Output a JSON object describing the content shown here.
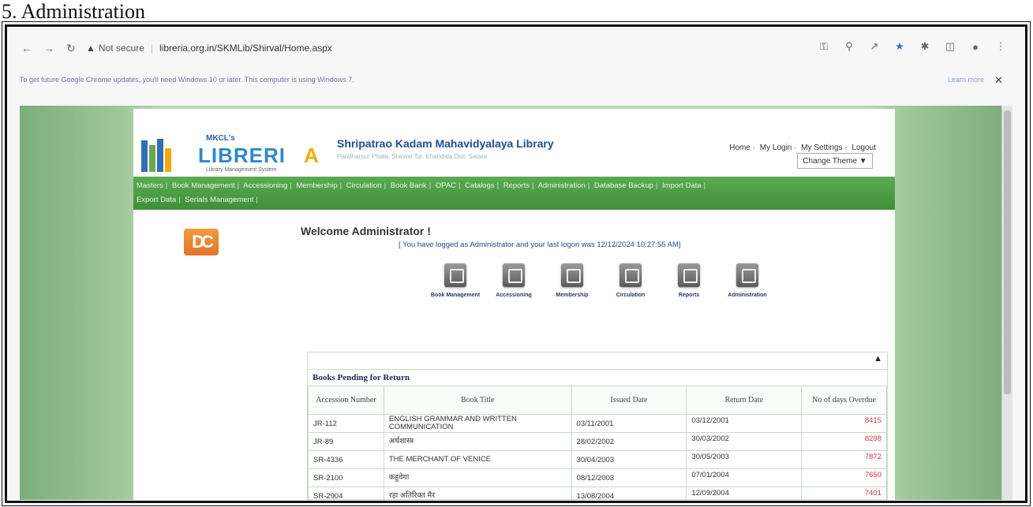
{
  "doc": {
    "heading": "5. Administration"
  },
  "browser": {
    "url_security": "Not secure",
    "url": "libreria.org.in/SKMLib/Shirval/Home.aspx",
    "infobar_text": "To get future Google Chrome updates, you'll need Windows 10 or later. This computer is using Windows 7.",
    "infobar_link": "Learn more"
  },
  "header": {
    "logo_small": "MKCL's",
    "logo_name": "LIBRERI",
    "logo_name_tail": "A",
    "logo_sub": "Library Management System",
    "library_name": "Shripatrao Kadam Mahavidyalaya Library",
    "library_address": "Pandharpur Phata, Shirwal Tal. Khandala Dist. Satara",
    "links": [
      "Home",
      "My Login",
      "My Settings",
      "Logout"
    ],
    "change_theme": "Change Theme"
  },
  "nav": {
    "row1": [
      "Masters",
      "Book Management",
      "Accessioning",
      "Membership",
      "Circulation",
      "Book Bank",
      "OPAC",
      "Catalogs",
      "Reports",
      "Administration",
      "Database Backup",
      "Import Data"
    ],
    "row2": [
      "Export Data",
      "Serials Management"
    ]
  },
  "main": {
    "welcome": "Welcome Administrator !",
    "logon_message": "[ You have logged as Administrator and your last logon was 12/12/2024 10:27:55 AM]",
    "quick_actions": [
      "Book Management",
      "Accessioning",
      "Membership",
      "Circulation",
      "Reports",
      "Administration"
    ]
  },
  "pending": {
    "title": "Books Pending for Return",
    "columns": [
      "Accession Number",
      "Book Title",
      "Issued Date",
      "Return Date",
      "No of days Overdue"
    ],
    "rows": [
      [
        "JR-112",
        "ENGLISH GRAMMAR AND WRITTEN COMMUNICATION",
        "03/11/2001",
        "03/12/2001",
        "8415"
      ],
      [
        "JR-89",
        "अर्थशास्त्र",
        "28/02/2002",
        "30/03/2002",
        "8298"
      ],
      [
        "SR-4336",
        "THE MERCHANT OF VENICE",
        "30/04/2003",
        "30/05/2003",
        "7872"
      ],
      [
        "SR-2100",
        "कहुवेगा",
        "08/12/2003",
        "07/01/2004",
        "7650"
      ],
      [
        "SR-2904",
        "रहा अतिरिक्त मैर",
        "13/08/2004",
        "12/09/2004",
        "7401"
      ]
    ]
  }
}
